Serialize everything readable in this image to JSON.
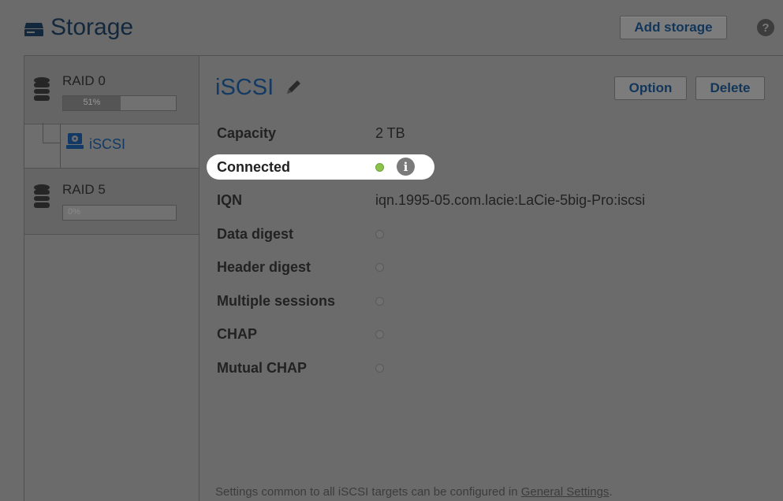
{
  "header": {
    "title": "Storage",
    "icon": "drive-icon",
    "add_storage_label": "Add storage",
    "help_glyph": "?"
  },
  "sidebar": {
    "items": [
      {
        "label": "RAID 0",
        "usage_text": "51%",
        "usage_fraction": 0.51,
        "icon": "database-icon"
      },
      {
        "label": "iSCSI",
        "icon": "iscsi-drive-icon"
      },
      {
        "label": "RAID 5",
        "usage_text": "0%",
        "usage_fraction": 0.0,
        "icon": "database-icon"
      }
    ]
  },
  "detail": {
    "title": "iSCSI",
    "option_label": "Option",
    "delete_label": "Delete",
    "fields": {
      "capacity": {
        "label": "Capacity",
        "value": "2 TB"
      },
      "connected": {
        "label": "Connected",
        "state": "on",
        "info_glyph": "i"
      },
      "iqn": {
        "label": "IQN",
        "value": "iqn.1995-05.com.lacie:LaCie-5big-Pro:iscsi"
      },
      "data_digest": {
        "label": "Data digest",
        "state": "off"
      },
      "header_digest": {
        "label": "Header digest",
        "state": "off"
      },
      "multiple_sessions": {
        "label": "Multiple sessions",
        "state": "off"
      },
      "chap": {
        "label": "CHAP",
        "state": "off"
      },
      "mutual_chap": {
        "label": "Mutual CHAP",
        "state": "off"
      }
    },
    "footer_text": "Settings common to all iSCSI targets can be configured in ",
    "footer_link": "General Settings",
    "footer_end": "."
  },
  "colors": {
    "accent": "#133a63",
    "connected": "#8bc34a",
    "highlight": "#ffffff"
  }
}
